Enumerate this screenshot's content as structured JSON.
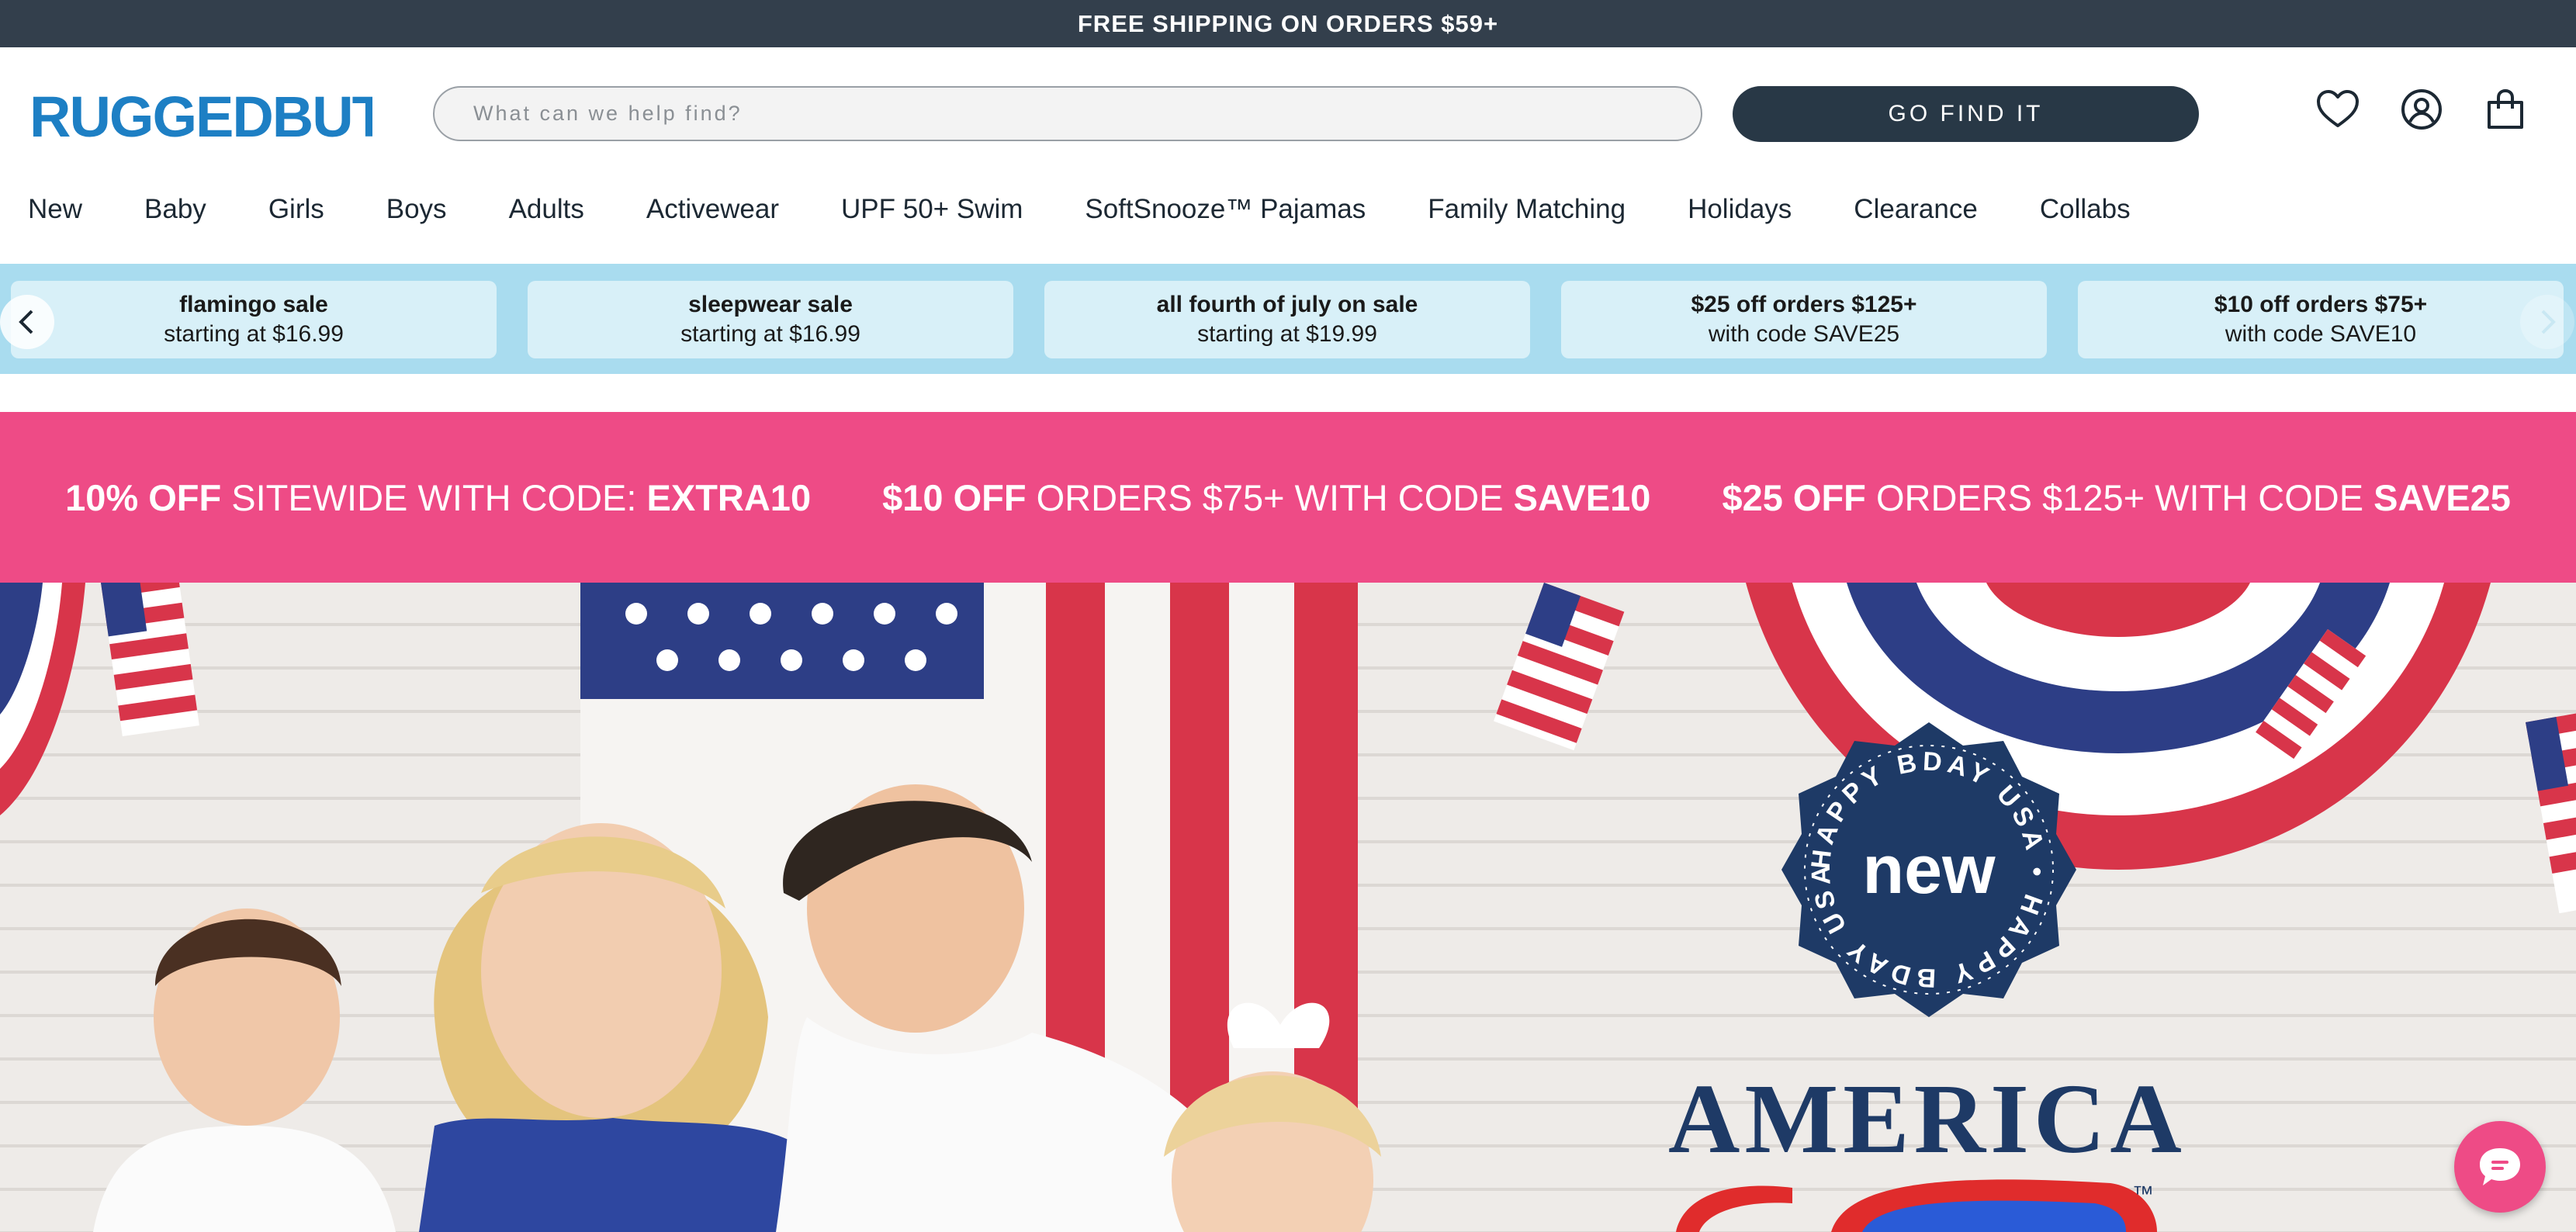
{
  "announcement": {
    "text": "FREE SHIPPING ON ORDERS $59+"
  },
  "header": {
    "brand": "RUGGEDBUTTS",
    "search_placeholder": "What can we help find?",
    "go_button": "GO FIND IT",
    "icons": [
      "heart-icon",
      "account-icon",
      "shopping-bag-icon"
    ]
  },
  "nav": {
    "items": [
      "New",
      "Baby",
      "Girls",
      "Boys",
      "Adults",
      "Activewear",
      "UPF 50+ Swim",
      "SoftSnooze™ Pajamas",
      "Family Matching",
      "Holidays",
      "Clearance",
      "Collabs"
    ]
  },
  "promos": [
    {
      "title": "flamingo sale",
      "subtitle": "starting at $16.99"
    },
    {
      "title": "sleepwear sale",
      "subtitle": "starting at $16.99"
    },
    {
      "title": "all fourth of july on sale",
      "subtitle": "starting at $19.99"
    },
    {
      "title": "$25 off orders $125+",
      "subtitle": "with code SAVE25"
    },
    {
      "title": "$10 off orders $75+",
      "subtitle": "with code SAVE10"
    }
  ],
  "offer_banner": {
    "offers": [
      {
        "bold": "10% OFF",
        "middle": "SITEWIDE WITH CODE:",
        "code": "EXTRA10"
      },
      {
        "bold": "$10 OFF",
        "middle": "ORDERS $75+ WITH CODE",
        "code": "SAVE10"
      },
      {
        "bold": "$25 OFF",
        "middle": "ORDERS $125+ WITH CODE",
        "code": "SAVE25"
      }
    ]
  },
  "hero": {
    "badge_word": "new",
    "badge_ring_text": "HAPPY BDAY USA • HAPPY BDAY USA •",
    "title": "AMERICA",
    "tm": "™"
  },
  "colors": {
    "announcement_bg": "#333f4c",
    "button_bg": "#283846",
    "promo_strip_bg": "#a9dcef",
    "promo_card_bg": "#d8f0f8",
    "offer_bg": "#ee4b86",
    "brand_blue": "#1d7fc4",
    "navy": "#1e3a66"
  }
}
